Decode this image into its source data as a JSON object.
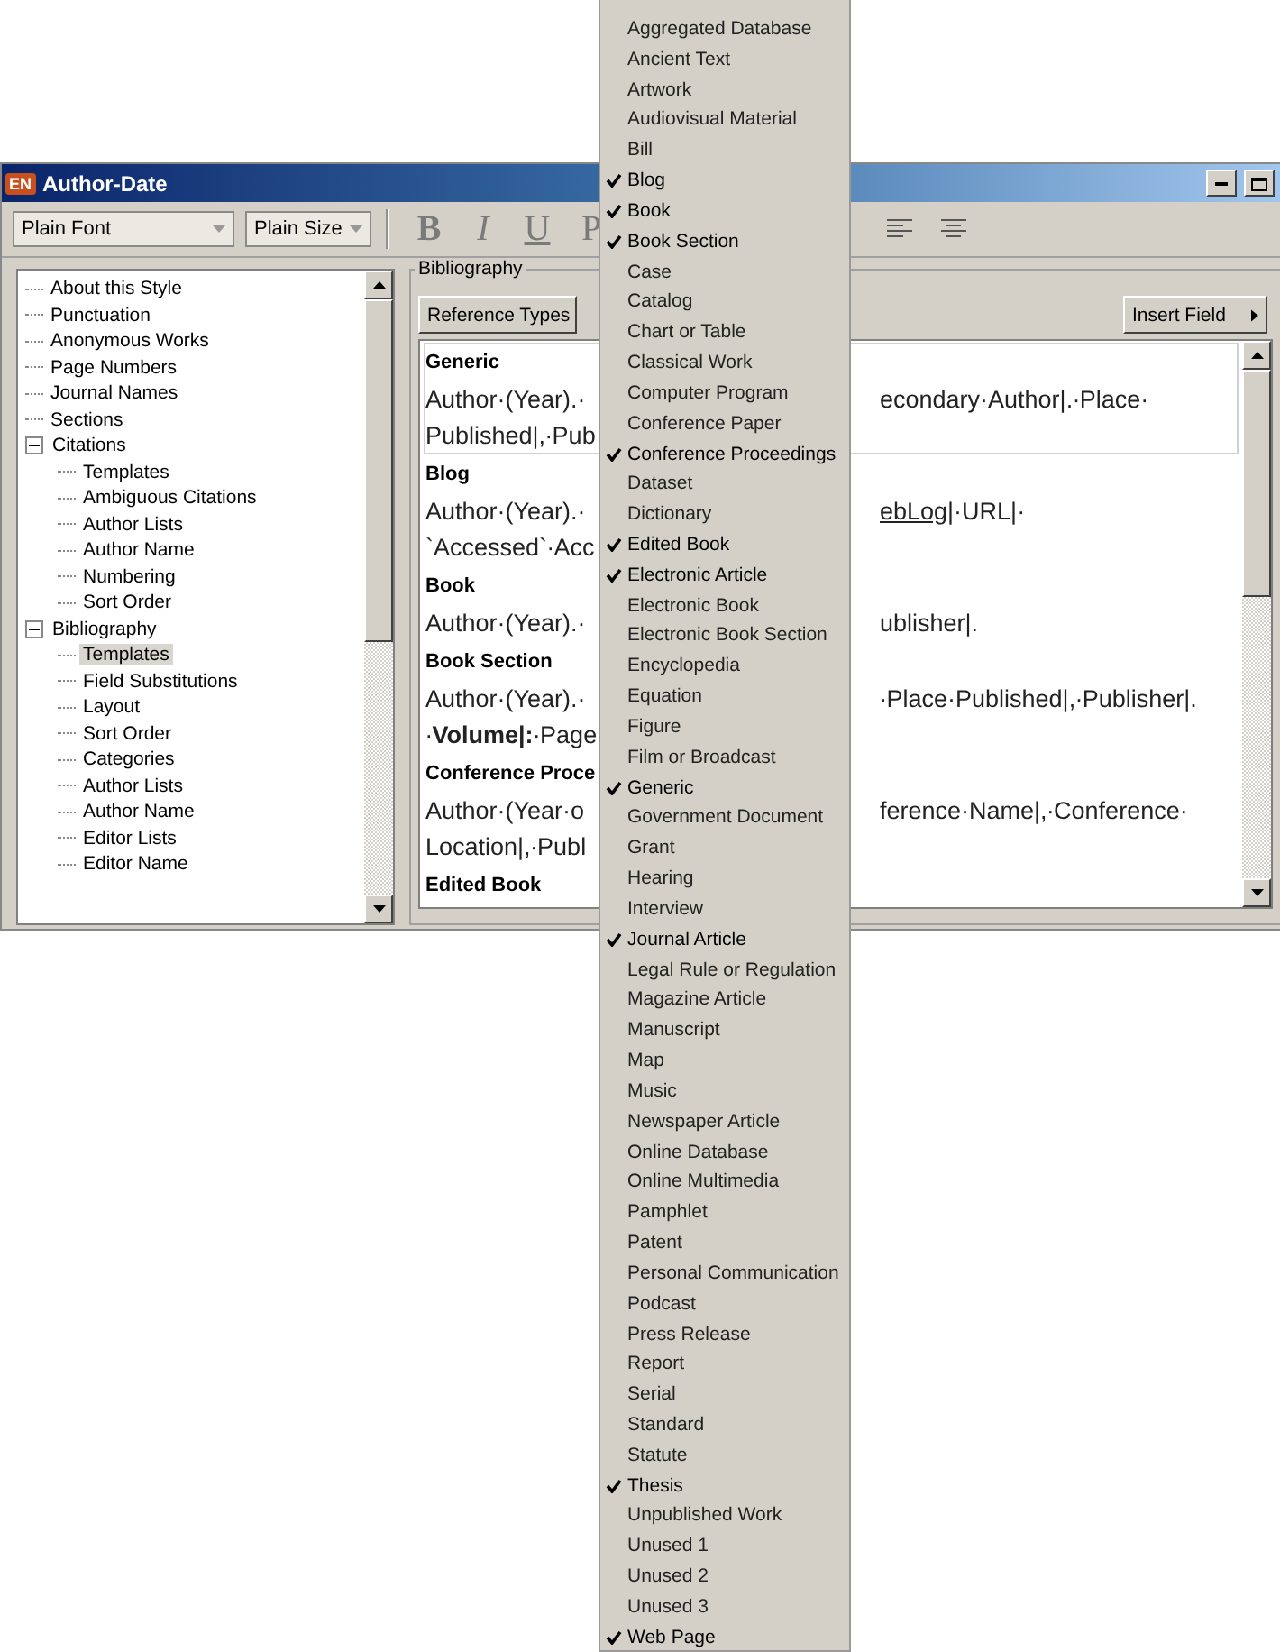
{
  "window": {
    "app_badge": "EN",
    "title": "Author-Date"
  },
  "toolbar": {
    "font": "Plain Font",
    "size": "Plain Size",
    "format_buttons": [
      {
        "label": "B",
        "kind": "bold"
      },
      {
        "label": "I",
        "kind": "italic"
      },
      {
        "label": "U",
        "kind": "underline"
      },
      {
        "label": "P",
        "kind": "plain"
      }
    ]
  },
  "tree": [
    {
      "label": "About this Style",
      "selected": false
    },
    {
      "label": "Punctuation",
      "selected": false
    },
    {
      "label": "Anonymous Works",
      "selected": false
    },
    {
      "label": "Page Numbers",
      "selected": false
    },
    {
      "label": "Journal Names",
      "selected": false
    },
    {
      "label": "Sections",
      "selected": false
    },
    {
      "label": "Citations",
      "selected": false,
      "expanded": true,
      "children": [
        {
          "label": "Templates",
          "selected": false
        },
        {
          "label": "Ambiguous Citations",
          "selected": false
        },
        {
          "label": "Author Lists",
          "selected": false
        },
        {
          "label": "Author Name",
          "selected": false
        },
        {
          "label": "Numbering",
          "selected": false
        },
        {
          "label": "Sort Order",
          "selected": false
        }
      ]
    },
    {
      "label": "Bibliography",
      "selected": false,
      "expanded": true,
      "children": [
        {
          "label": "Templates",
          "selected": true
        },
        {
          "label": "Field Substitutions",
          "selected": false
        },
        {
          "label": "Layout",
          "selected": false
        },
        {
          "label": "Sort Order",
          "selected": false
        },
        {
          "label": "Categories",
          "selected": false
        },
        {
          "label": "Author Lists",
          "selected": false
        },
        {
          "label": "Author Name",
          "selected": false
        },
        {
          "label": "Editor Lists",
          "selected": false
        },
        {
          "label": "Editor Name",
          "selected": false
        }
      ]
    }
  ],
  "group": {
    "title": "Bibliography",
    "reference_types_button": "Reference Types",
    "insert_field_button": "Insert Field"
  },
  "templates": [
    {
      "heading": "Generic",
      "selected": true,
      "lines": [
        {
          "left": [
            {
              "text": "Author·(Year).·"
            }
          ],
          "right": [
            {
              "text": "econdary·Author|.∙Place·"
            }
          ]
        },
        {
          "left": [
            {
              "text": "Published|,∙Pub"
            }
          ]
        }
      ]
    },
    {
      "heading": "Blog",
      "selected": false,
      "lines": [
        {
          "left": [
            {
              "text": "Author·(Year).·"
            }
          ],
          "right": [
            {
              "text": "ebLog",
              "kind": "underlined"
            },
            {
              "text": "|·URL|·"
            }
          ]
        },
        {
          "left": [
            {
              "text": "`Accessed`∙Acc"
            }
          ]
        }
      ]
    },
    {
      "heading": "Book",
      "selected": false,
      "lines": [
        {
          "left": [
            {
              "text": "Author·(Year).·"
            }
          ],
          "right": [
            {
              "text": "ublisher|."
            }
          ]
        }
      ]
    },
    {
      "heading": "Book Section",
      "selected": false,
      "lines": [
        {
          "left": [
            {
              "text": "Author·(Year).·"
            }
          ],
          "right": [
            {
              "text": "∙Place·Published|,∙Publisher|."
            }
          ]
        },
        {
          "left": [
            {
              "text": "∙"
            },
            {
              "text": "Volume|:",
              "kind": "bold"
            },
            {
              "text": "∙Page"
            }
          ]
        }
      ]
    },
    {
      "heading": "Conference Proce",
      "selected": false,
      "lines": [
        {
          "left": [
            {
              "text": "Author·(Year·o"
            }
          ],
          "right": [
            {
              "text": "ference·Name|,∙Conference·"
            }
          ]
        },
        {
          "left": [
            {
              "text": "Location|,∙Publ"
            }
          ]
        }
      ]
    },
    {
      "heading": "Edited Book",
      "selected": false
    }
  ],
  "menu": [
    {
      "label": "Aggregated Database",
      "checked": false
    },
    {
      "label": "Ancient Text",
      "checked": false
    },
    {
      "label": "Artwork",
      "checked": false
    },
    {
      "label": "Audiovisual Material",
      "checked": false
    },
    {
      "label": "Bill",
      "checked": false
    },
    {
      "label": "Blog",
      "checked": true
    },
    {
      "label": "Book",
      "checked": true
    },
    {
      "label": "Book Section",
      "checked": true
    },
    {
      "label": "Case",
      "checked": false
    },
    {
      "label": "Catalog",
      "checked": false
    },
    {
      "label": "Chart or Table",
      "checked": false
    },
    {
      "label": "Classical Work",
      "checked": false
    },
    {
      "label": "Computer Program",
      "checked": false
    },
    {
      "label": "Conference Paper",
      "checked": false
    },
    {
      "label": "Conference Proceedings",
      "checked": true
    },
    {
      "label": "Dataset",
      "checked": false
    },
    {
      "label": "Dictionary",
      "checked": false
    },
    {
      "label": "Edited Book",
      "checked": true
    },
    {
      "label": "Electronic Article",
      "checked": true
    },
    {
      "label": "Electronic Book",
      "checked": false
    },
    {
      "label": "Electronic Book Section",
      "checked": false
    },
    {
      "label": "Encyclopedia",
      "checked": false
    },
    {
      "label": "Equation",
      "checked": false
    },
    {
      "label": "Figure",
      "checked": false
    },
    {
      "label": "Film or Broadcast",
      "checked": false
    },
    {
      "label": "Generic",
      "checked": true
    },
    {
      "label": "Government Document",
      "checked": false
    },
    {
      "label": "Grant",
      "checked": false
    },
    {
      "label": "Hearing",
      "checked": false
    },
    {
      "label": "Interview",
      "checked": false
    },
    {
      "label": "Journal Article",
      "checked": true
    },
    {
      "label": "Legal Rule or Regulation",
      "checked": false
    },
    {
      "label": "Magazine Article",
      "checked": false
    },
    {
      "label": "Manuscript",
      "checked": false
    },
    {
      "label": "Map",
      "checked": false
    },
    {
      "label": "Music",
      "checked": false
    },
    {
      "label": "Newspaper Article",
      "checked": false
    },
    {
      "label": "Online Database",
      "checked": false
    },
    {
      "label": "Online Multimedia",
      "checked": false
    },
    {
      "label": "Pamphlet",
      "checked": false
    },
    {
      "label": "Patent",
      "checked": false
    },
    {
      "label": "Personal Communication",
      "checked": false
    },
    {
      "label": "Podcast",
      "checked": false
    },
    {
      "label": "Press Release",
      "checked": false
    },
    {
      "label": "Report",
      "checked": false
    },
    {
      "label": "Serial",
      "checked": false
    },
    {
      "label": "Standard",
      "checked": false
    },
    {
      "label": "Statute",
      "checked": false
    },
    {
      "label": "Thesis",
      "checked": true
    },
    {
      "label": "Unpublished Work",
      "checked": false
    },
    {
      "label": "Unused 1",
      "checked": false
    },
    {
      "label": "Unused 2",
      "checked": false
    },
    {
      "label": "Unused 3",
      "checked": false
    },
    {
      "label": "Web Page",
      "checked": true
    }
  ]
}
